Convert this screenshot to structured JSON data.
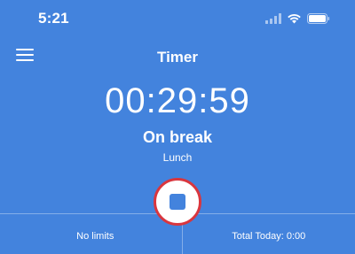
{
  "status_bar": {
    "time": "5:21",
    "icons": [
      "cellular-signal-icon",
      "wifi-icon",
      "battery-icon"
    ]
  },
  "header": {
    "title": "Timer",
    "menu_icon": "hamburger-menu-icon"
  },
  "timer": {
    "value": "00:29:59",
    "status": "On break",
    "category": "Lunch"
  },
  "controls": {
    "stop_icon": "stop-icon",
    "stop_button_border_color": "#d9363e"
  },
  "footer": {
    "left_label": "No limits",
    "right_label": "Total Today: 0:00"
  },
  "colors": {
    "background": "#4383dd",
    "text": "#ffffff",
    "accent_red": "#d9363e"
  }
}
